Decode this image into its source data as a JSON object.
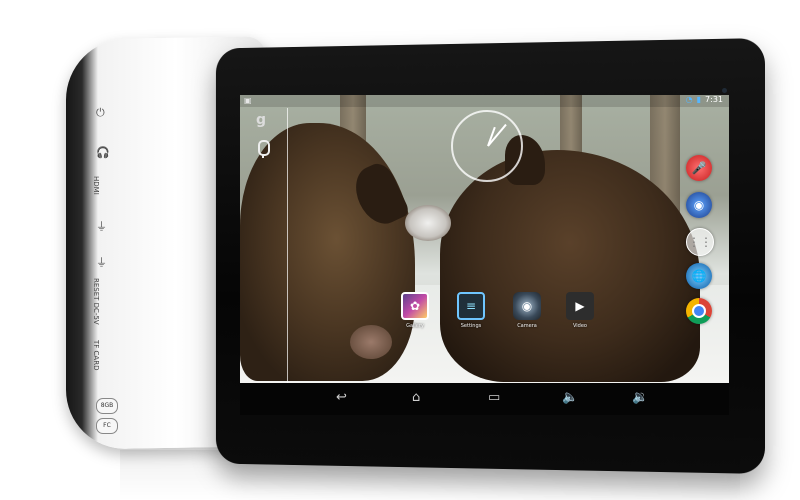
{
  "device": {
    "side_labels": [
      "HDMI",
      "RESET  DC-5V",
      "TF CARD"
    ],
    "badges": [
      "8GB",
      "FC"
    ]
  },
  "status_bar": {
    "time": "7:31",
    "wifi_icon": "wifi-icon",
    "battery_icon": "battery-icon"
  },
  "apps": [
    {
      "label": "Gallery",
      "icon": "gallery-icon"
    },
    {
      "label": "Settings",
      "icon": "settings-icon"
    },
    {
      "label": "Camera",
      "icon": "camera-icon"
    },
    {
      "label": "Video",
      "icon": "video-icon"
    }
  ],
  "dock": [
    {
      "icon": "voice-search-icon"
    },
    {
      "icon": "sound-icon"
    },
    {
      "icon": "all-apps-icon"
    },
    {
      "icon": "browser-icon"
    },
    {
      "icon": "chrome-icon"
    }
  ],
  "nav": {
    "back_icon": "back-icon",
    "home_icon": "home-icon",
    "recent_icon": "recent-apps-icon",
    "vol_down_icon": "volume-down-icon",
    "vol_up_icon": "volume-up-icon"
  }
}
